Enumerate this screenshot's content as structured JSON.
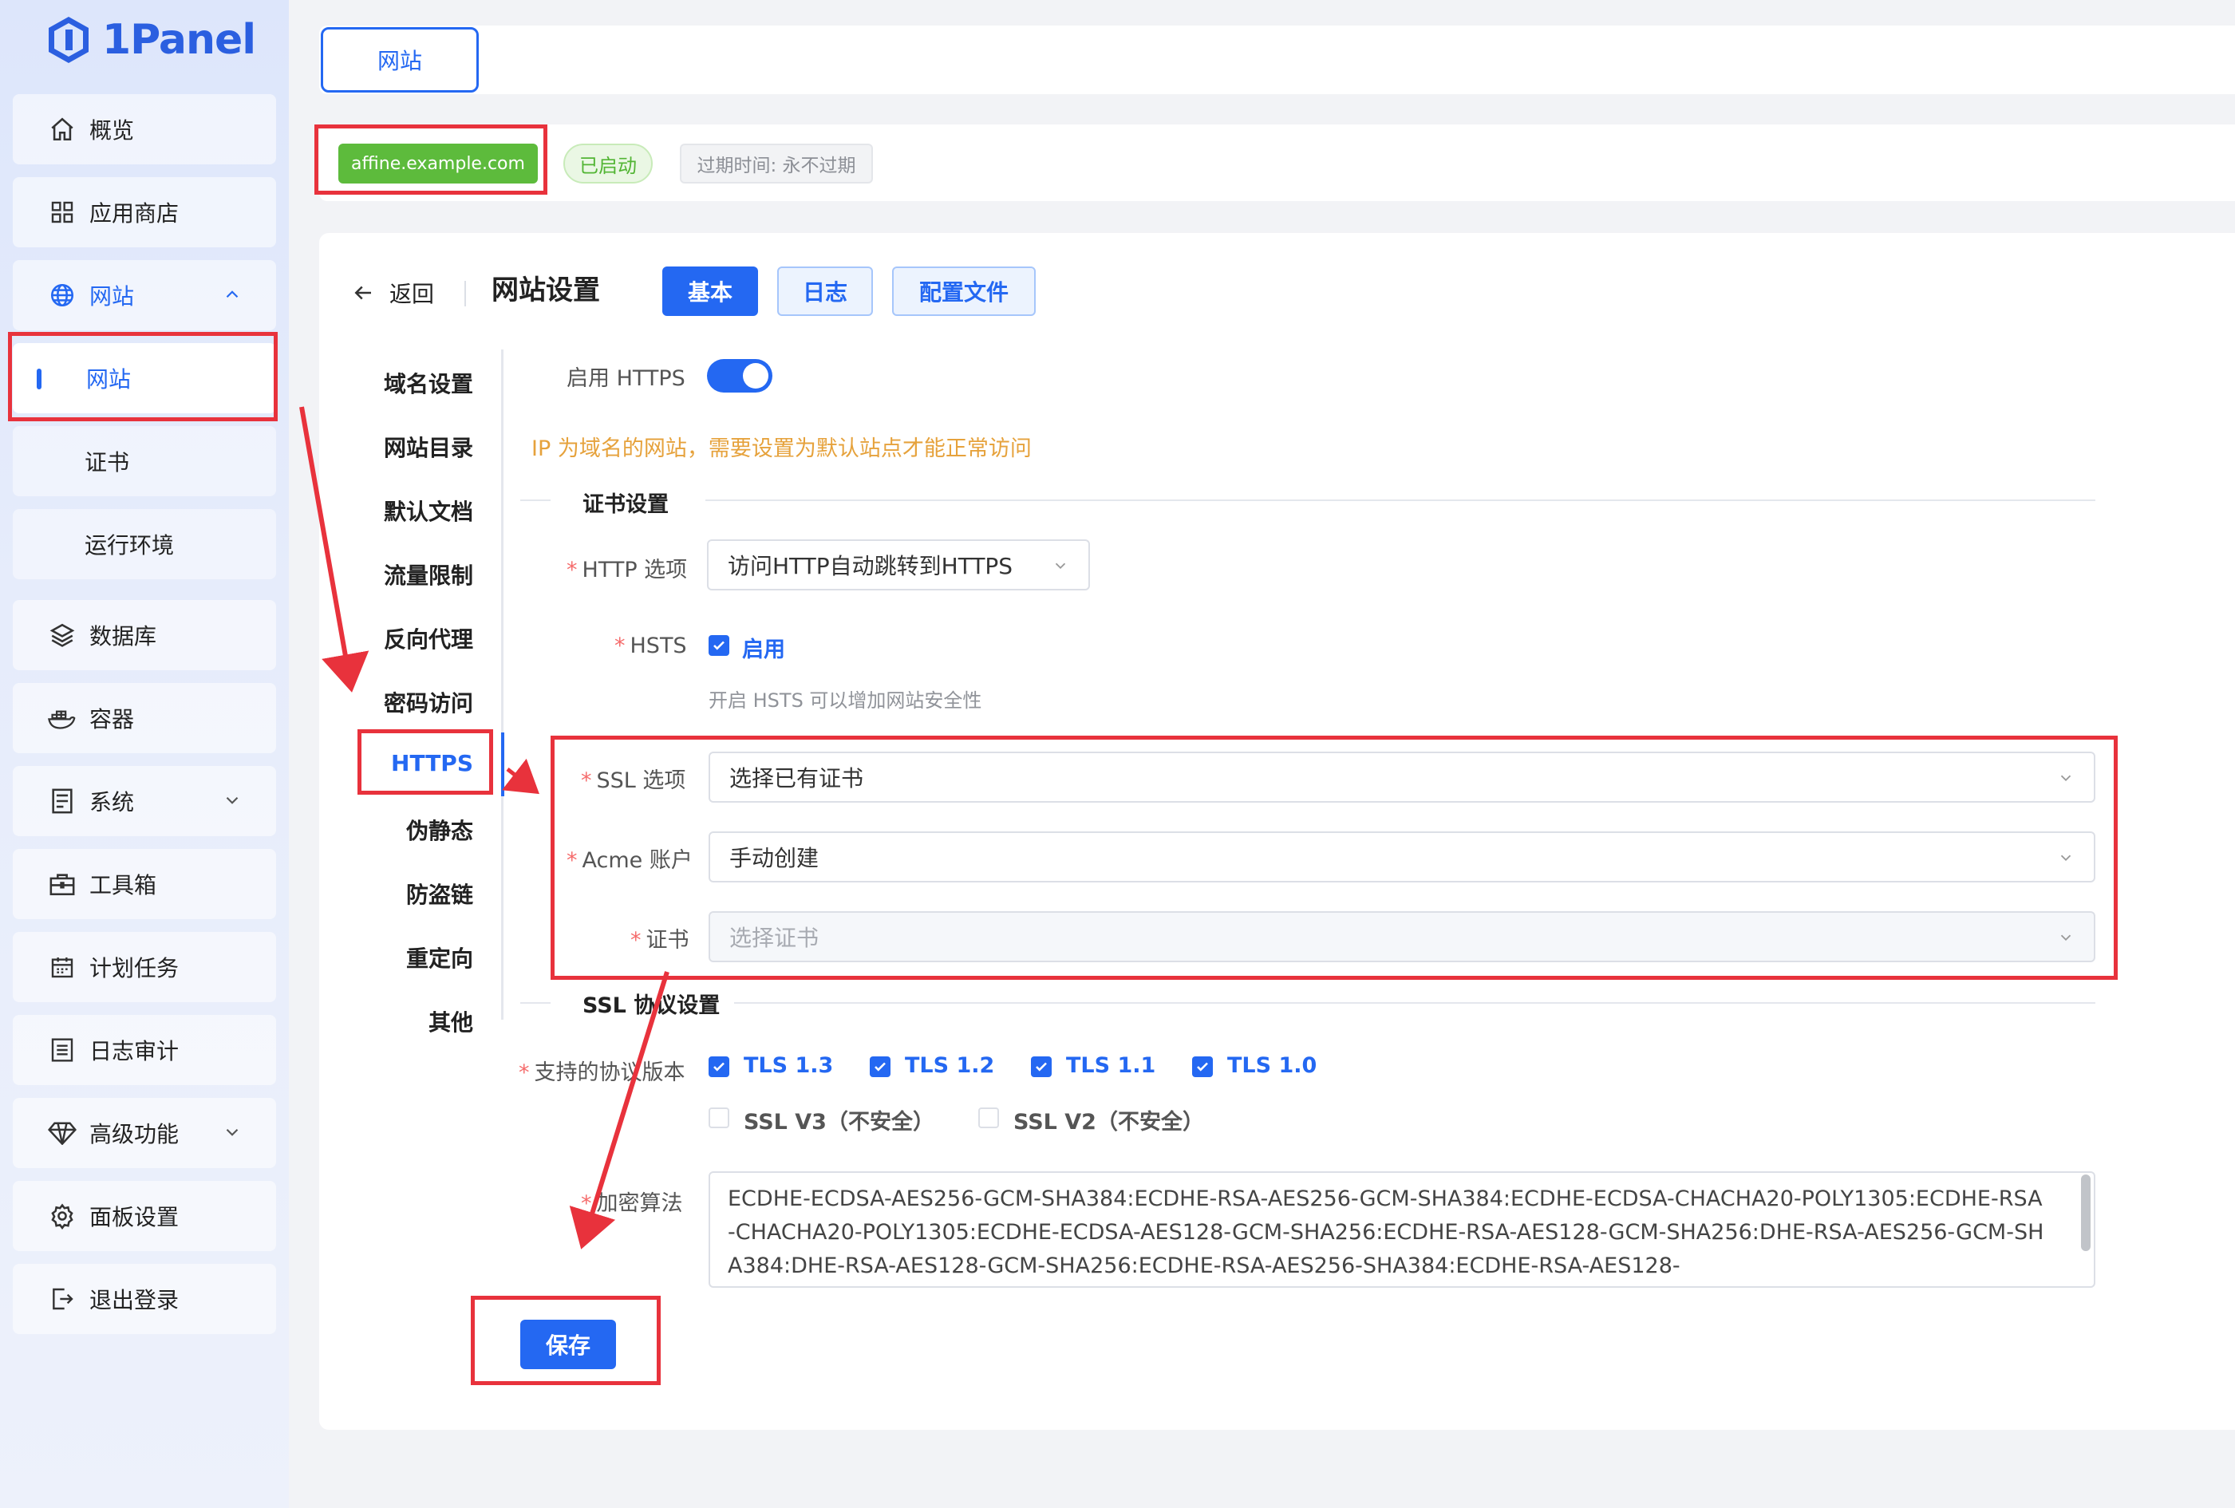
{
  "app": {
    "logo_text": "1Panel"
  },
  "sidebar": {
    "items": [
      {
        "label": "概览",
        "icon": "home-icon"
      },
      {
        "label": "应用商店",
        "icon": "grid-icon"
      },
      {
        "label": "网站",
        "icon": "globe-icon",
        "expanded": true
      },
      {
        "label": "网站",
        "sub": true,
        "selected": true
      },
      {
        "label": "证书",
        "sub": true
      },
      {
        "label": "运行环境",
        "sub": true
      },
      {
        "label": "数据库",
        "icon": "layers-icon"
      },
      {
        "label": "容器",
        "icon": "docker-icon"
      },
      {
        "label": "系统",
        "icon": "server-icon",
        "has_chevron": true
      },
      {
        "label": "工具箱",
        "icon": "toolbox-icon"
      },
      {
        "label": "计划任务",
        "icon": "calendar-icon"
      },
      {
        "label": "日志审计",
        "icon": "log-icon"
      },
      {
        "label": "高级功能",
        "icon": "diamond-icon",
        "has_chevron": true
      },
      {
        "label": "面板设置",
        "icon": "gear-icon"
      },
      {
        "label": "退出登录",
        "icon": "logout-icon"
      }
    ]
  },
  "top_tab": {
    "label": "网站"
  },
  "site_info": {
    "domain": "affine.example.com",
    "status": "已启动",
    "expire": "过期时间: 永不过期"
  },
  "header": {
    "back_label": "返回",
    "title": "网站设置",
    "tabs": [
      "基本",
      "日志",
      "配置文件"
    ]
  },
  "submenu": [
    "域名设置",
    "网站目录",
    "默认文档",
    "流量限制",
    "反向代理",
    "密码访问",
    "HTTPS",
    "伪静态",
    "防盗链",
    "重定向",
    "其他"
  ],
  "form": {
    "enable_https_label": "启用 HTTPS",
    "enable_https": true,
    "warning": "IP 为域名的网站，需要设置为默认站点才能正常访问",
    "cert_section": "证书设置",
    "http_option_label": "HTTP 选项",
    "http_option_value": "访问HTTP自动跳转到HTTPS",
    "hsts_label": "HSTS",
    "hsts_check_label": "启用",
    "hsts_hint": "开启 HSTS 可以增加网站安全性",
    "ssl_option_label": "SSL 选项",
    "ssl_option_value": "选择已有证书",
    "acme_label": "Acme 账户",
    "acme_value": "手动创建",
    "cert_label": "证书",
    "cert_placeholder": "选择证书",
    "ssl_protocol_section": "SSL 协议设置",
    "protocol_label": "支持的协议版本",
    "protocols": [
      {
        "label": "TLS 1.3",
        "checked": true
      },
      {
        "label": "TLS 1.2",
        "checked": true
      },
      {
        "label": "TLS 1.1",
        "checked": true
      },
      {
        "label": "TLS 1.0",
        "checked": true
      },
      {
        "label": "SSL V3（不安全）",
        "checked": false
      },
      {
        "label": "SSL V2（不安全）",
        "checked": false
      }
    ],
    "cipher_label": "加密算法",
    "cipher_value": "ECDHE-ECDSA-AES256-GCM-SHA384:ECDHE-RSA-AES256-GCM-SHA384:ECDHE-ECDSA-CHACHA20-POLY1305:ECDHE-RSA-CHACHA20-POLY1305:ECDHE-ECDSA-AES128-GCM-SHA256:ECDHE-RSA-AES128-GCM-SHA256:DHE-RSA-AES256-GCM-SHA384:DHE-RSA-AES128-GCM-SHA256:ECDHE-RSA-AES256-SHA384:ECDHE-RSA-AES128-",
    "save_label": "保存"
  },
  "colors": {
    "accent": "#2468f2",
    "annotation": "#e8323c",
    "success": "#5dbb3c",
    "warning": "#e6a23c"
  }
}
